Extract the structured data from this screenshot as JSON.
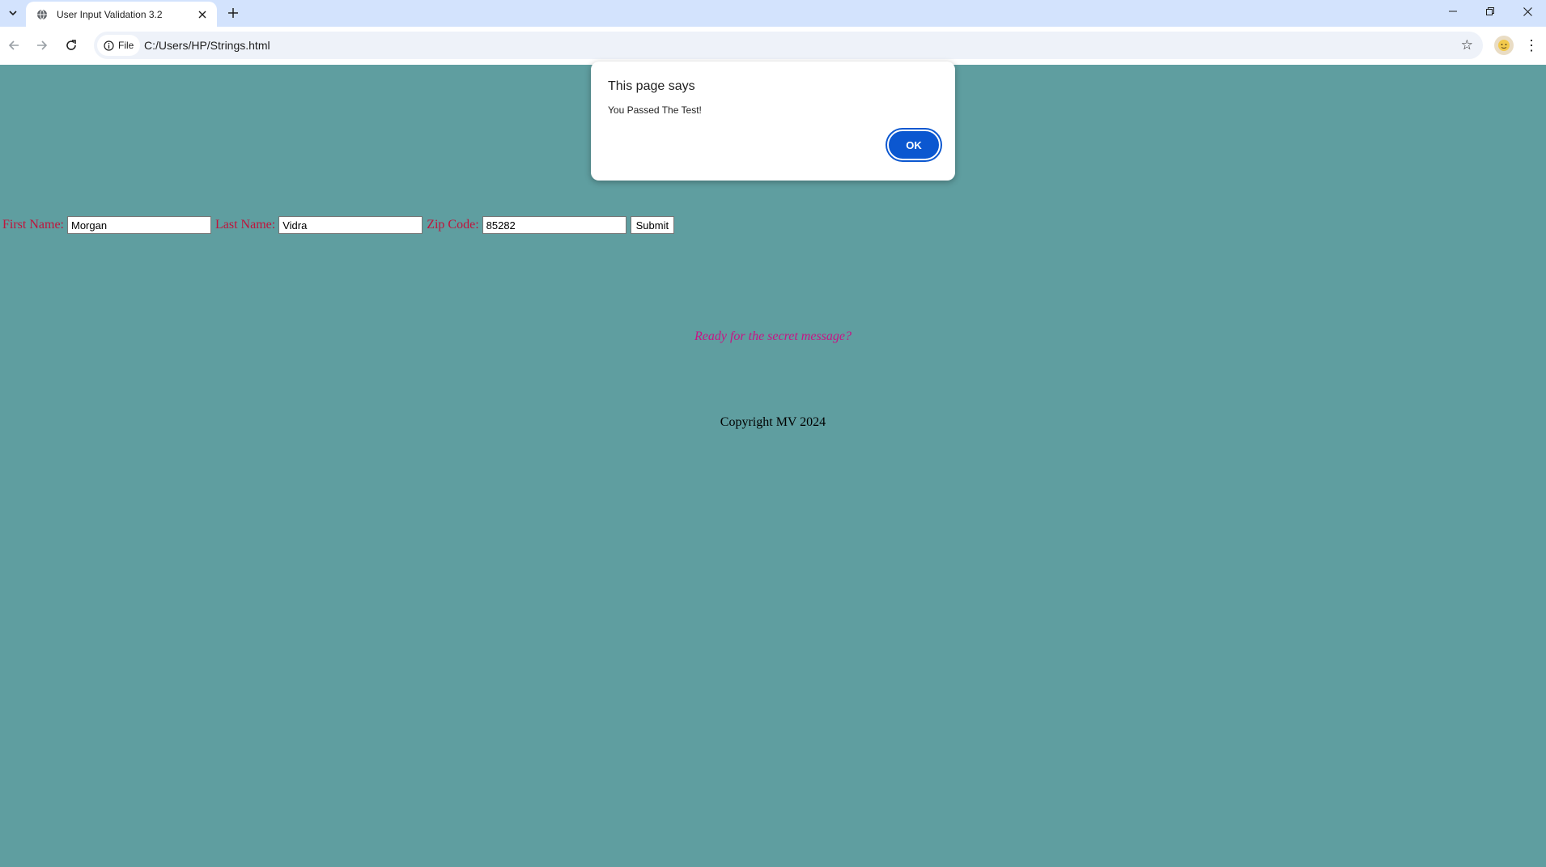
{
  "browser": {
    "tab_title": "User Input Validation 3.2",
    "site_chip_label": "File",
    "url": "C:/Users/HP/Strings.html"
  },
  "icons": {
    "tab_search": "chevron-down-icon",
    "favicon": "globe-icon",
    "tab_close": "close-icon",
    "new_tab": "plus-icon",
    "back": "arrow-left-icon",
    "forward": "arrow-right-icon",
    "reload": "reload-icon",
    "site_info": "info-icon",
    "bookmark": "star-icon",
    "profile": "avatar",
    "menu": "kebab-menu-icon",
    "minimize": "minimize-icon",
    "restore": "restore-icon",
    "close_window": "close-icon"
  },
  "form": {
    "first_name_label": "First Name:",
    "first_name_value": "Morgan",
    "last_name_label": "Last Name:",
    "last_name_value": "Vidra",
    "zip_label": "Zip Code:",
    "zip_value": "85282",
    "submit_label": "Submit"
  },
  "page": {
    "secret_message": "Ready for the secret message?",
    "copyright": "Copyright MV 2024"
  },
  "dialog": {
    "title": "This page says",
    "message": "You Passed The Test!",
    "ok_label": "OK"
  },
  "colors": {
    "page_background": "#5f9ea0",
    "label_color": "#c0143c",
    "secret_color": "#c71585",
    "ok_button": "#0b57d0",
    "tabstrip": "#d3e3fd"
  }
}
